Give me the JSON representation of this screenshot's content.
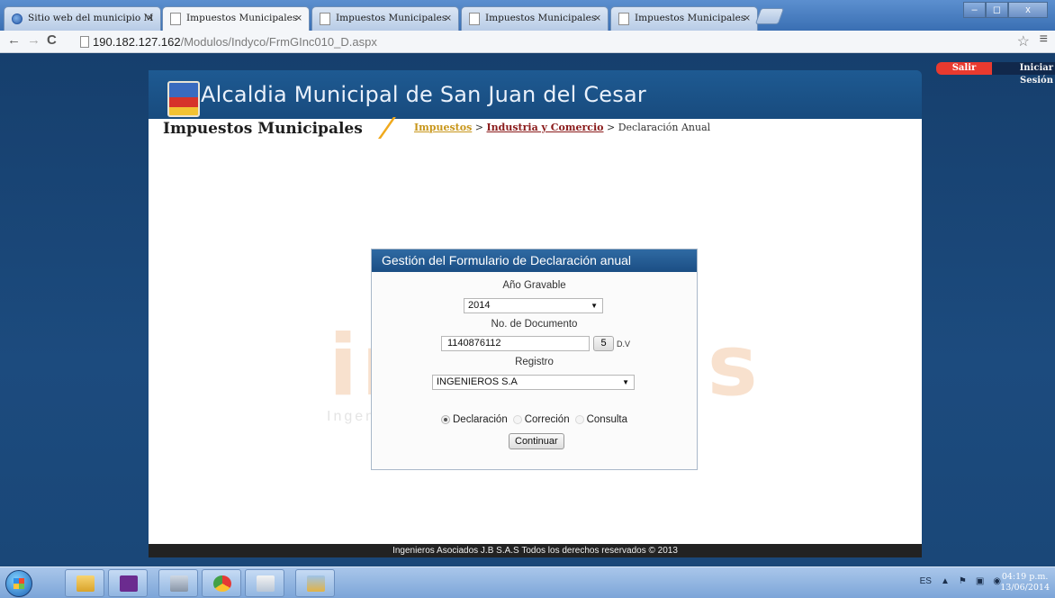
{
  "browser": {
    "tabs": [
      {
        "label": "Sitio web del municipio M",
        "icon": "globe-icon"
      },
      {
        "label": "Impuestos Municipales",
        "icon": "page-icon"
      },
      {
        "label": "Impuestos Municipales",
        "icon": "page-icon"
      },
      {
        "label": "Impuestos Municipales",
        "icon": "page-icon"
      },
      {
        "label": "Impuestos Municipales",
        "icon": "page-icon"
      }
    ],
    "tab_close": "×",
    "url_host": "190.182.127.162",
    "url_path": "/Modulos/Indyco/FrmGInc010_D.aspx"
  },
  "session": {
    "logout": "Salir",
    "login": "Iniciar Sesión"
  },
  "site": {
    "banner_title": "Alcaldia Municipal de San Juan del Cesar",
    "app_title": "Impuestos Municipales",
    "breadcrumb": {
      "first": "Impuestos",
      "sep": ">",
      "second": "Industria y Comercio",
      "current": "Declaración Anual"
    },
    "watermark": "ingenias",
    "watermark_sub": "Ingenieros            J.B S.A.S",
    "footer": "Ingenieros Asociados J.B S.A.S Todos los derechos reservados © 2013"
  },
  "form": {
    "title": "Gestión del Formulario de Declaración anual",
    "year_label": "Año Gravable",
    "year_value": "2014",
    "doc_label": "No. de Documento",
    "doc_value": "1140876112",
    "dv_value": "5",
    "dv_label": "D.V",
    "registro_label": "Registro",
    "registro_value": "INGENIEROS S.A",
    "radios": [
      {
        "label": "Declaración",
        "selected": true
      },
      {
        "label": "Correción",
        "selected": false
      },
      {
        "label": "Consulta",
        "selected": false
      }
    ],
    "submit": "Continuar"
  },
  "taskbar": {
    "lang": "ES",
    "time": "04:19 p.m.",
    "date": "13/06/2014"
  }
}
